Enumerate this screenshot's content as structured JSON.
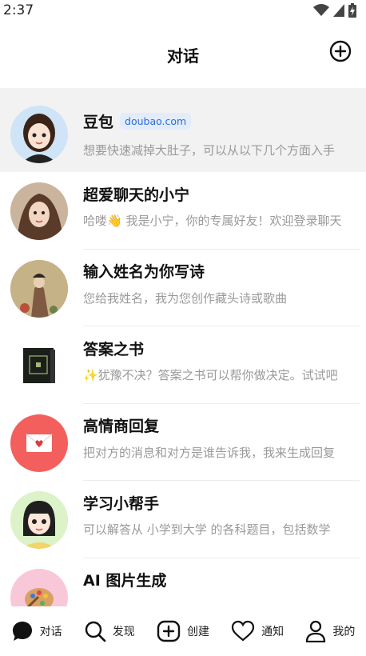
{
  "status_bar": {
    "time": "2:37"
  },
  "header": {
    "title": "对话"
  },
  "chats": [
    {
      "name": "豆包",
      "tag": "doubao.com",
      "preview": "想要快速减掉大肚子，可以从以下几个方面入手",
      "avatar": "girl-avatar"
    },
    {
      "name": "超爱聊天的小宁",
      "preview": "哈喽👋 我是小宁，你的专属好友！欢迎登录聊天",
      "avatar": "portrait-avatar"
    },
    {
      "name": "输入姓名为你写诗",
      "preview": "您给我姓名，我为您创作藏头诗或歌曲",
      "avatar": "painting-avatar"
    },
    {
      "name": "答案之书",
      "preview": "✨犹豫不决？答案之书可以帮你做决定。试试吧",
      "avatar": "book-avatar"
    },
    {
      "name": "高情商回复",
      "preview": "把对方的消息和对方是谁告诉我，我来生成回复",
      "avatar": "envelope-avatar"
    },
    {
      "name": "学习小帮手",
      "preview": "可以解答从 小学到大学 的各科题目，包括数学",
      "avatar": "student-avatar"
    },
    {
      "name": "AI 图片生成",
      "preview": "",
      "avatar": "palette-avatar"
    }
  ],
  "tabs": [
    {
      "label": "对话",
      "icon": "chat-bubble-icon"
    },
    {
      "label": "发现",
      "icon": "search-icon"
    },
    {
      "label": "创建",
      "icon": "plus-square-icon"
    },
    {
      "label": "通知",
      "icon": "heart-icon"
    },
    {
      "label": "我的",
      "icon": "person-icon"
    }
  ],
  "colors": {
    "pinned_bg": "#f2f2f2",
    "tag_text": "#2d6ed4",
    "tag_bg": "#e3ecfa",
    "envelope_avatar_bg": "#f25f5c"
  }
}
